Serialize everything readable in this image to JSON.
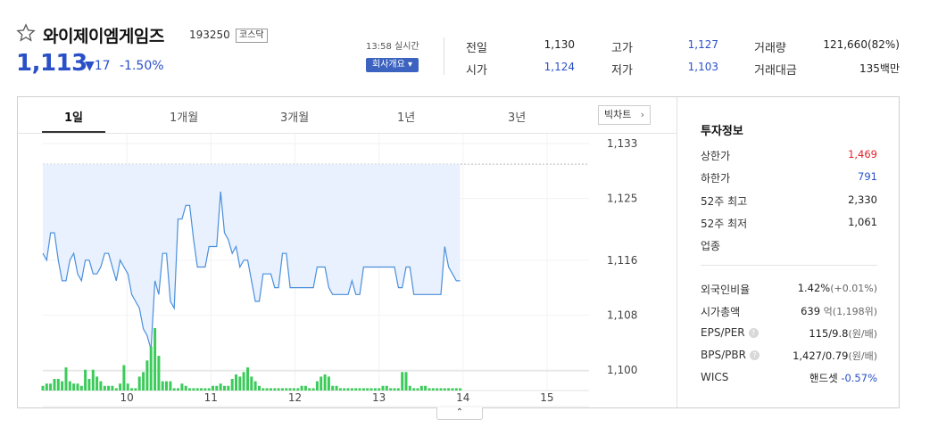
{
  "stock": {
    "name": "와이제이엠게임즈",
    "code": "193250",
    "market": "코스닥",
    "price": "1,113",
    "change": "▼17",
    "change_pct": "-1.50%",
    "time": "13:58 실시간",
    "company_button": "회사개요 ▾"
  },
  "quote": {
    "prev_close_label": "전일",
    "prev_close": "1,130",
    "open_label": "시가",
    "open": "1,124",
    "high_label": "고가",
    "high": "1,127",
    "low_label": "저가",
    "low": "1,103",
    "volume_label": "거래량",
    "volume": "121,660(82%)",
    "amount_label": "거래대금",
    "amount": "135백만"
  },
  "tabs": [
    "1일",
    "1개월",
    "3개월",
    "1년",
    "3년"
  ],
  "bigchart_label": "빅차트",
  "chart_data": {
    "type": "line",
    "price_axis": [
      1133,
      1125,
      1116,
      1108,
      1100
    ],
    "price_axis_labels": [
      "1,133",
      "1,125",
      "1,116",
      "1,108",
      "1,100"
    ],
    "x_labels": [
      "10",
      "11",
      "12",
      "13",
      "14",
      "15"
    ],
    "ylim": [
      1100,
      1133
    ],
    "prev_close": 1130,
    "series": [
      {
        "values": [
          1117,
          1116,
          1120,
          1120,
          1116,
          1113,
          1113,
          1116,
          1117,
          1114,
          1113,
          1116,
          1116,
          1114,
          1114,
          1115,
          1117,
          1117,
          1115,
          1113,
          1116,
          1115,
          1114,
          1111,
          1110,
          1109,
          1106,
          1105,
          1103,
          1113,
          1111,
          1117,
          1117,
          1110,
          1109,
          1122,
          1122,
          1124,
          1124,
          1119,
          1115,
          1115,
          1115,
          1118,
          1118,
          1118,
          1126,
          1120,
          1119,
          1117,
          1118,
          1115,
          1116,
          1116,
          1113,
          1110,
          1110,
          1114,
          1114,
          1114,
          1112,
          1112,
          1117,
          1117,
          1112,
          1112,
          1112,
          1112,
          1112,
          1112,
          1112,
          1115,
          1115,
          1115,
          1112,
          1111,
          1111,
          1111,
          1111,
          1111,
          1113,
          1111,
          1111,
          1115,
          1115,
          1115,
          1115,
          1115,
          1115,
          1115,
          1115,
          1115,
          1112,
          1112,
          1115,
          1115,
          1111,
          1111,
          1111,
          1111,
          1111,
          1111,
          1111,
          1111,
          1118,
          1115,
          1114,
          1113,
          1113
        ]
      }
    ],
    "volume": [
      2,
      3,
      3,
      5,
      5,
      4,
      10,
      4,
      3,
      3,
      2,
      9,
      5,
      9,
      6,
      4,
      2,
      2,
      2,
      1,
      3,
      11,
      3,
      1,
      1,
      6,
      8,
      13,
      19,
      27,
      15,
      4,
      4,
      4,
      1,
      1,
      3,
      2,
      1,
      1,
      1,
      1,
      1,
      1,
      2,
      2,
      3,
      2,
      2,
      5,
      7,
      6,
      8,
      10,
      6,
      4,
      2,
      1,
      1,
      1,
      1,
      1,
      1,
      1,
      1,
      1,
      1,
      2,
      2,
      1,
      1,
      4,
      6,
      7,
      6,
      2,
      2,
      1,
      1,
      1,
      1,
      1,
      1,
      1,
      1,
      1,
      1,
      1,
      2,
      2,
      1,
      1,
      1,
      8,
      8,
      2,
      1,
      1,
      2,
      2,
      1,
      1,
      1,
      1,
      1,
      1,
      1,
      1,
      1
    ]
  },
  "info": {
    "title": "투자정보",
    "upper_label": "상한가",
    "upper": "1,469",
    "lower_label": "하한가",
    "lower": "791",
    "high52_label": "52주 최고",
    "high52": "2,330",
    "low52_label": "52주 최저",
    "low52": "1,061",
    "sector_label": "업종",
    "foreign_label": "외국인비율",
    "foreign": "1.42%",
    "foreign_change": "(+0.01%)",
    "mcap_label": "시가총액",
    "mcap": "639",
    "mcap_unit": "억(1,198위)",
    "eps_label": "EPS/PER",
    "eps": "115/9.8",
    "eps_unit": "(원/배)",
    "bps_label": "BPS/PBR",
    "bps": "1,427/0.79",
    "bps_unit": "(원/배)",
    "wics_label": "WICS",
    "wics": "핸드셋",
    "wics_change": "-0.57%",
    "help_glyph": "?"
  },
  "collapse_glyph": "⌃",
  "colors": {
    "up": "#e0222b",
    "down": "#2a50c8",
    "line": "#4a8fdc",
    "fill": "#e8f1fd",
    "volume": "#3ccb5b"
  }
}
